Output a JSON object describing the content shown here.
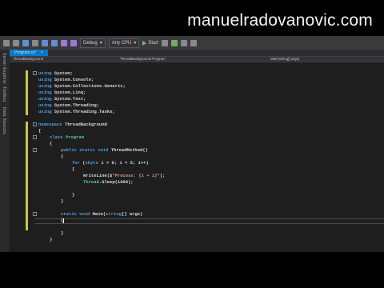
{
  "watermark": "manuelradovanovic.com",
  "toolbar": {
    "config": "Debug",
    "platform": "Any CPU",
    "start_label": "Start"
  },
  "side_panels": [
    "Server Explorer",
    "Toolbox",
    "Data Sources"
  ],
  "tabs": [
    {
      "label": "Program.cs*"
    }
  ],
  "nav": {
    "project": "ThreadBackground",
    "class": "ThreadBackground.Program",
    "member": "Main(string[] args)"
  },
  "code": [
    {
      "indent": 0,
      "parts": [
        [
          "kw",
          "using"
        ],
        [
          "tx",
          " System;"
        ]
      ]
    },
    {
      "indent": 0,
      "parts": [
        [
          "kw",
          "using"
        ],
        [
          "tx",
          " System.Console;"
        ]
      ]
    },
    {
      "indent": 0,
      "parts": [
        [
          "kw",
          "using"
        ],
        [
          "tx",
          " System.Collections.Generic;"
        ]
      ]
    },
    {
      "indent": 0,
      "parts": [
        [
          "kw",
          "using"
        ],
        [
          "tx",
          " System.Linq;"
        ]
      ]
    },
    {
      "indent": 0,
      "parts": [
        [
          "kw",
          "using"
        ],
        [
          "tx",
          " System.Text;"
        ]
      ]
    },
    {
      "indent": 0,
      "parts": [
        [
          "kw",
          "using"
        ],
        [
          "tx",
          " System.Threading;"
        ]
      ]
    },
    {
      "indent": 0,
      "parts": [
        [
          "kw",
          "using"
        ],
        [
          "tx",
          " System.Threading.Tasks;"
        ]
      ]
    },
    {
      "indent": 0,
      "parts": []
    },
    {
      "indent": 0,
      "parts": [
        [
          "kw",
          "namespace"
        ],
        [
          "tx",
          " ThreadBackground"
        ]
      ]
    },
    {
      "indent": 0,
      "parts": [
        [
          "tx",
          "{"
        ]
      ]
    },
    {
      "indent": 1,
      "parts": [
        [
          "kw",
          "class"
        ],
        [
          "tx",
          " "
        ],
        [
          "ty",
          "Program"
        ]
      ]
    },
    {
      "indent": 1,
      "parts": [
        [
          "tx",
          "{"
        ]
      ]
    },
    {
      "indent": 2,
      "parts": [
        [
          "kw",
          "public static void"
        ],
        [
          "tx",
          " ThreadMethod()"
        ]
      ]
    },
    {
      "indent": 2,
      "parts": [
        [
          "tx",
          "{"
        ]
      ]
    },
    {
      "indent": 3,
      "parts": [
        [
          "kw",
          "for"
        ],
        [
          "tx",
          " ("
        ],
        [
          "kw",
          "sbyte"
        ],
        [
          "tx",
          " i = 0; i < 5; i++)"
        ]
      ]
    },
    {
      "indent": 3,
      "parts": [
        [
          "tx",
          "{"
        ]
      ]
    },
    {
      "indent": 4,
      "parts": [
        [
          "tx",
          "WriteLine($"
        ],
        [
          "st",
          "\"Process: {i + 1}\""
        ],
        [
          "tx",
          ");"
        ]
      ]
    },
    {
      "indent": 4,
      "parts": [
        [
          "ty",
          "Thread"
        ],
        [
          "tx",
          ".Sleep(1000);"
        ]
      ]
    },
    {
      "indent": 0,
      "parts": []
    },
    {
      "indent": 3,
      "parts": [
        [
          "tx",
          "}"
        ]
      ]
    },
    {
      "indent": 2,
      "parts": [
        [
          "tx",
          "}"
        ]
      ]
    },
    {
      "indent": 0,
      "parts": []
    },
    {
      "indent": 2,
      "parts": [
        [
          "kw",
          "static void"
        ],
        [
          "tx",
          " Main("
        ],
        [
          "kw",
          "string"
        ],
        [
          "tx",
          "[] args)"
        ]
      ]
    },
    {
      "indent": 2,
      "parts": [
        [
          "tx",
          "{"
        ]
      ],
      "caret": true
    },
    {
      "indent": 2,
      "parts": []
    },
    {
      "indent": 2,
      "parts": [
        [
          "tx",
          "}"
        ]
      ]
    },
    {
      "indent": 1,
      "parts": [
        [
          "tx",
          "}"
        ]
      ]
    }
  ]
}
